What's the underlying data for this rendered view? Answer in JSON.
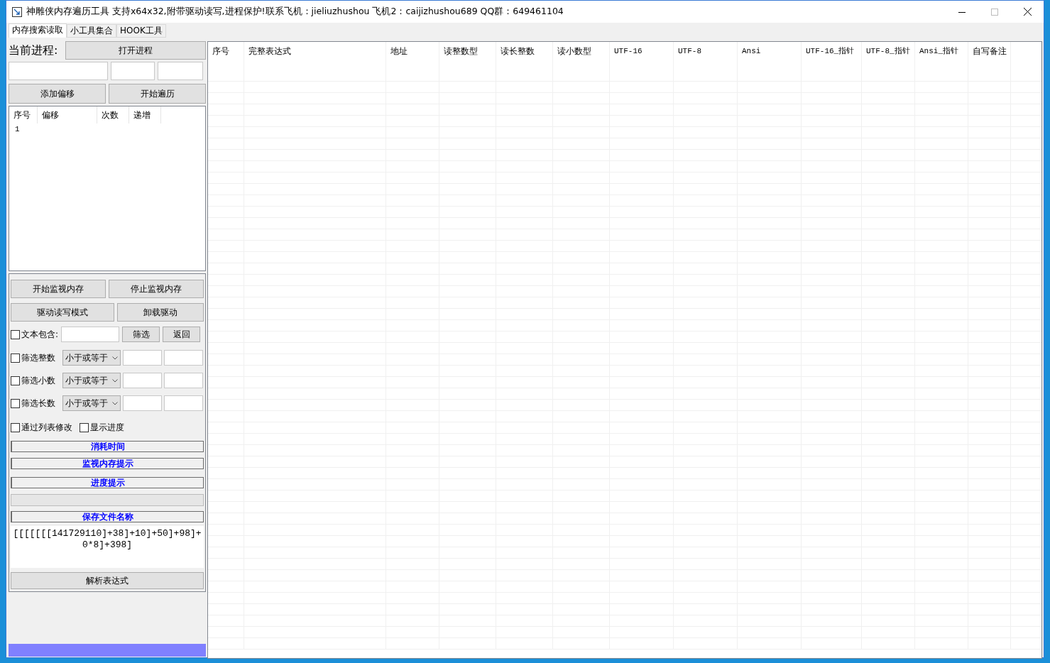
{
  "window": {
    "title": "神雕侠内存遍历工具  支持x64x32,附带驱动读写,进程保护!联系飞机：jieliuzhushou 飞机2：caijizhushou689 QQ群：649461104"
  },
  "tabs": [
    {
      "label": "内存搜索读取",
      "selected": true
    },
    {
      "label": "小工具集合",
      "selected": false
    },
    {
      "label": "HOOK工具",
      "selected": false
    }
  ],
  "process": {
    "label": "当前进程:",
    "button": "打开进程"
  },
  "add_offset_button": "添加偏移",
  "start_traverse_button": "开始遍历",
  "offset_list": {
    "columns": [
      "序号",
      "偏移",
      "次数",
      "递增"
    ],
    "rows": [
      [
        "1"
      ]
    ]
  },
  "monitor_buttons": [
    [
      "开始监视内存",
      "停止监视内存"
    ],
    [
      "驱动读写模式",
      "卸载驱动"
    ]
  ],
  "text_filter": {
    "label": "文本包含:",
    "checked": false,
    "buttons": [
      "筛选",
      "返回"
    ]
  },
  "number_filters": [
    {
      "label": "筛选整数",
      "checked": false,
      "operator": "小于或等于"
    },
    {
      "label": "筛选小数",
      "checked": false,
      "operator": "小于或等于"
    },
    {
      "label": "筛选长数",
      "checked": false,
      "operator": "小于或等于"
    }
  ],
  "options": [
    {
      "label": "通过列表修改",
      "checked": false
    },
    {
      "label": "显示进度",
      "checked": false
    }
  ],
  "info_labels": [
    "消耗时间",
    "监视内存提示",
    "进度提示"
  ],
  "save_label": "保存文件名称",
  "expression": "[[[[[[[141729110]+38]+10]+50]+98]+0*8]+398]",
  "parse_button": "解析表达式",
  "table": {
    "columns": [
      "序号",
      "完整表达式",
      "地址",
      "读整数型",
      "读长整数",
      "读小数型",
      "UTF-16",
      "UTF-8",
      "Ansi",
      "UTF-16_指针",
      "UTF-8_指针",
      "Ansi_指针",
      "自写备注"
    ]
  }
}
